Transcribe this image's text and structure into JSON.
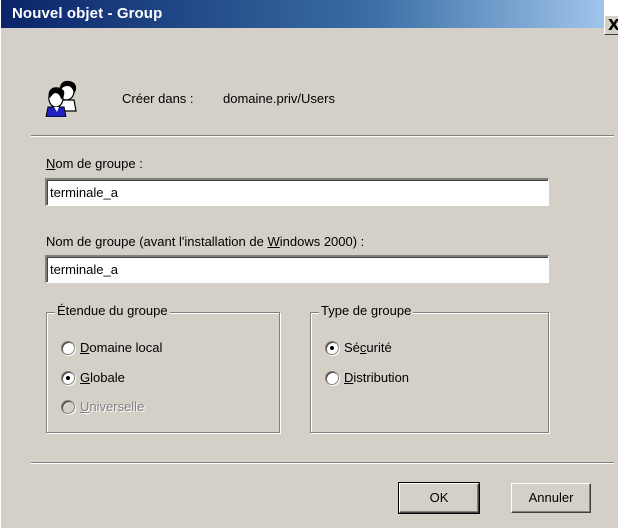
{
  "window": {
    "title": "Nouvel objet - Group",
    "close_glyph": "X"
  },
  "header": {
    "icon": "group-users-icon",
    "create_in_label": "Créer dans :",
    "create_in_value": "domaine.priv/Users"
  },
  "group_name": {
    "label_first": "N",
    "label_rest": "om de groupe :",
    "value": "terminale_a"
  },
  "group_name_pre2000": {
    "label_before": "Nom de groupe (avant l'installation de ",
    "label_underlined": "W",
    "label_after": "indows 2000) :",
    "value": "terminale_a"
  },
  "scope": {
    "legend": "Étendue du groupe",
    "options": [
      {
        "first": "D",
        "rest": "omaine local",
        "checked": false,
        "disabled": false
      },
      {
        "first": "G",
        "rest": "lobale",
        "checked": true,
        "disabled": false
      },
      {
        "first": "U",
        "rest": "niverselle",
        "checked": false,
        "disabled": true
      }
    ]
  },
  "type": {
    "legend": "Type de groupe",
    "options": [
      {
        "before": "Sé",
        "underlined": "c",
        "after": "urité",
        "checked": true
      },
      {
        "before": "",
        "underlined": "D",
        "after": "istribution",
        "checked": false
      }
    ]
  },
  "buttons": {
    "ok": "OK",
    "cancel": "Annuler"
  },
  "colors": {
    "dialog_face": "#d4d0c8",
    "title_start": "#0a246a",
    "title_end": "#a6caf0"
  }
}
